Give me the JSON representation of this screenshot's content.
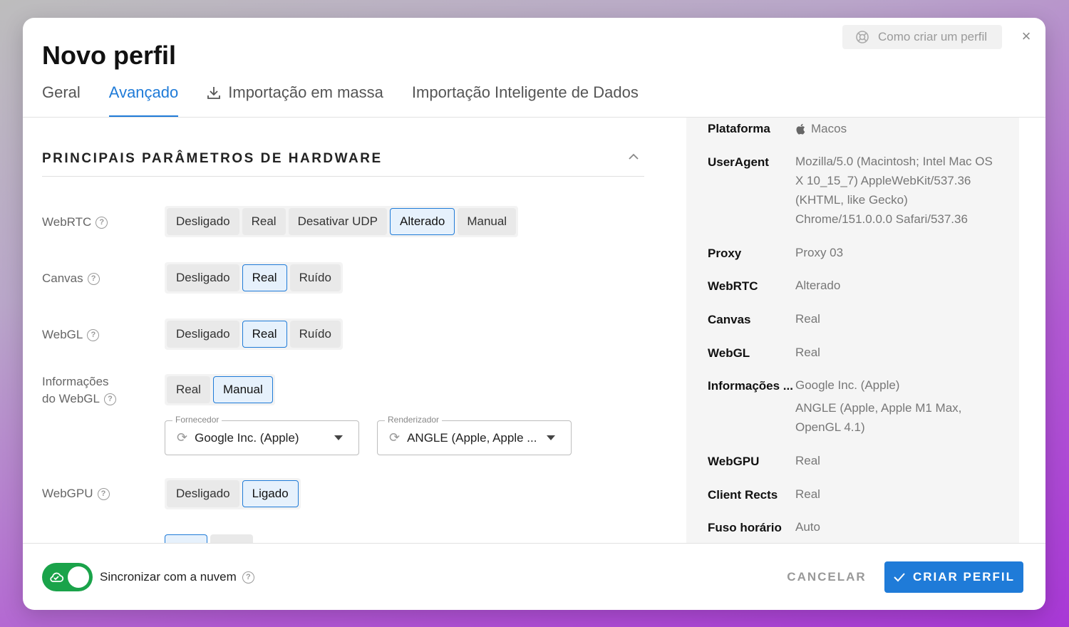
{
  "modal": {
    "title": "Novo perfil",
    "help_label": "Como criar um perfil",
    "close_glyph": "×"
  },
  "tabs": [
    {
      "label": "Geral",
      "active": false
    },
    {
      "label": "Avançado",
      "active": true
    },
    {
      "label": "Importação em massa",
      "icon": "download-icon",
      "active": false
    },
    {
      "label": "Importação Inteligente de Dados",
      "active": false
    }
  ],
  "hardware": {
    "section_title": "PRINCIPAIS PARÂMETROS DE HARDWARE",
    "webrtc": {
      "label": "WebRTC",
      "options": [
        "Desligado",
        "Real",
        "Desativar UDP",
        "Alterado",
        "Manual"
      ],
      "selected": "Alterado"
    },
    "canvas": {
      "label": "Canvas",
      "options": [
        "Desligado",
        "Real",
        "Ruído"
      ],
      "selected": "Real"
    },
    "webgl": {
      "label": "WebGL",
      "options": [
        "Desligado",
        "Real",
        "Ruído"
      ],
      "selected": "Real"
    },
    "webgl_info": {
      "label_line1": "Informações",
      "label_line2": "do WebGL",
      "options": [
        "Real",
        "Manual"
      ],
      "selected": "Manual",
      "vendor": {
        "label": "Fornecedor",
        "value": "Google Inc. (Apple)"
      },
      "renderer": {
        "label": "Renderizador",
        "value": "ANGLE (Apple, Apple ..."
      }
    },
    "webgpu": {
      "label": "WebGPU",
      "options": [
        "Desligado",
        "Ligado"
      ],
      "selected": "Ligado"
    }
  },
  "summary": {
    "platform": {
      "key": "Plataforma",
      "value": "Macos",
      "icon": "apple-icon"
    },
    "useragent": {
      "key": "UserAgent",
      "value": "Mozilla/5.0 (Macintosh; Intel Mac OS X 10_15_7) AppleWebKit/537.36 (KHTML, like Gecko) Chrome/151.0.0.0 Safari/537.36"
    },
    "proxy": {
      "key": "Proxy",
      "value": "Proxy 03"
    },
    "webrtc": {
      "key": "WebRTC",
      "value": "Alterado"
    },
    "canvas": {
      "key": "Canvas",
      "value": "Real"
    },
    "webgl": {
      "key": "WebGL",
      "value": "Real"
    },
    "webgl_info": {
      "key": "Informações ...",
      "value1": "Google Inc. (Apple)",
      "value2": "ANGLE (Apple, Apple M1 Max, OpenGL 4.1)"
    },
    "webgpu": {
      "key": "WebGPU",
      "value": "Real"
    },
    "client_rects": {
      "key": "Client Rects",
      "value": "Real"
    },
    "timezone": {
      "key": "Fuso horário",
      "value": "Auto"
    }
  },
  "footer": {
    "sync_label": "Sincronizar com a nuvem",
    "sync_enabled": true,
    "cancel_label": "CANCELAR",
    "create_label": "CRIAR PERFIL"
  },
  "colors": {
    "accent": "#1f7bd8",
    "toggle_on": "#1aa34a"
  }
}
